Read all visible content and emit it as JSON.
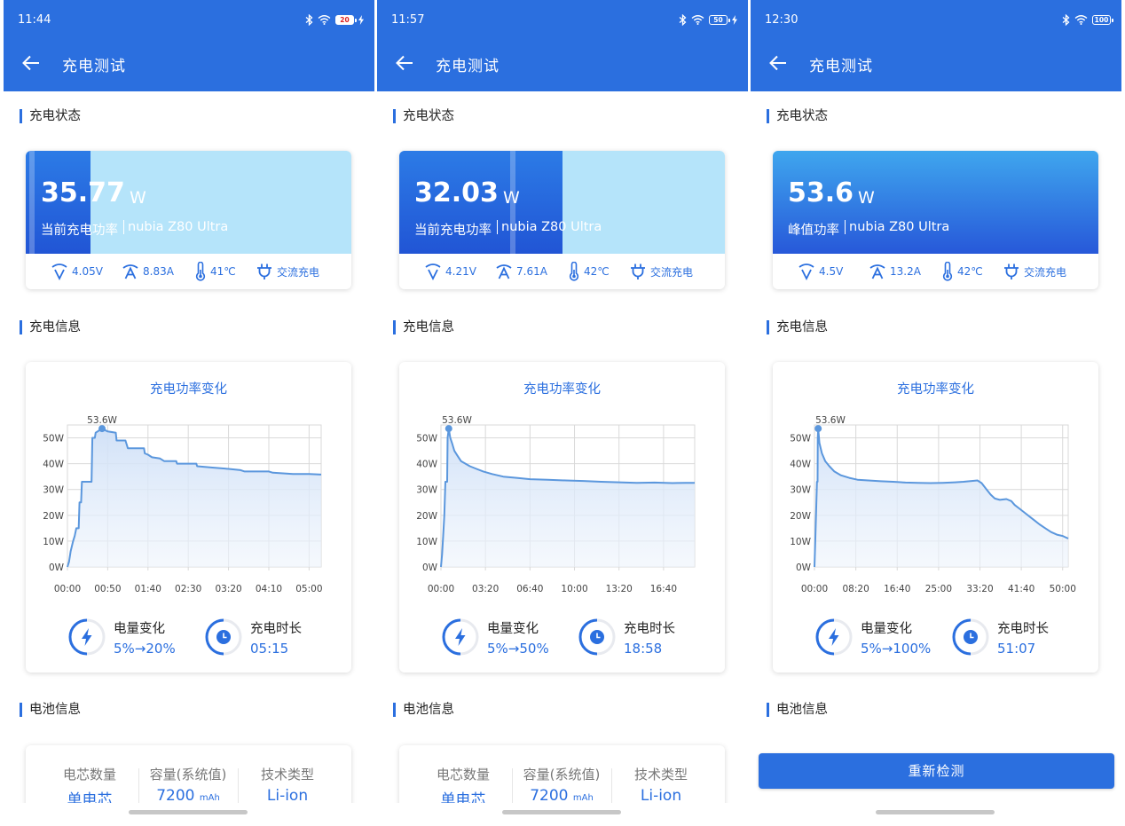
{
  "screens": [
    {
      "status_time": "11:44",
      "battery_level": "20",
      "battery_low": true,
      "charging_bolt": true,
      "title": "充电测试",
      "section_status": "充电状态",
      "power_value": "35.77",
      "power_unit": "W",
      "power_label": "当前充电功率",
      "device": "nubia Z80 Ultra",
      "power_fraction": 0.2,
      "voltage": "4.05V",
      "current": "8.83A",
      "temperature": "41℃",
      "mode": "交流充电",
      "section_info": "充电信息",
      "chart_title": "充电功率变化",
      "summary_battery_label": "电量变化",
      "summary_battery_value": "5%→20%",
      "summary_time_label": "充电时长",
      "summary_time_value": "05:15",
      "section_battery": "电池信息",
      "battery_info": {
        "cells_label": "电芯数量",
        "cells_value": "单电芯",
        "capacity_label": "容量(系统值)",
        "capacity_value": "7200",
        "capacity_unit": "mAh",
        "tech_label": "技术类型",
        "tech_value": "Li-ion"
      }
    },
    {
      "status_time": "11:57",
      "battery_level": "50",
      "battery_low": false,
      "charging_bolt": true,
      "title": "充电测试",
      "section_status": "充电状态",
      "power_value": "32.03",
      "power_unit": "W",
      "power_label": "当前充电功率",
      "device": "nubia Z80 Ultra",
      "power_fraction": 0.5,
      "voltage": "4.21V",
      "current": "7.61A",
      "temperature": "42℃",
      "mode": "交流充电",
      "section_info": "充电信息",
      "chart_title": "充电功率变化",
      "summary_battery_label": "电量变化",
      "summary_battery_value": "5%→50%",
      "summary_time_label": "充电时长",
      "summary_time_value": "18:58",
      "section_battery": "电池信息",
      "battery_info": {
        "cells_label": "电芯数量",
        "cells_value": "单电芯",
        "capacity_label": "容量(系统值)",
        "capacity_value": "7200",
        "capacity_unit": "mAh",
        "tech_label": "技术类型",
        "tech_value": "Li-ion"
      }
    },
    {
      "status_time": "12:30",
      "battery_level": "100",
      "battery_low": false,
      "charging_bolt": false,
      "title": "充电测试",
      "section_status": "充电状态",
      "power_value": "53.6",
      "power_unit": "W",
      "power_label": "峰值功率",
      "device": "nubia Z80 Ultra",
      "power_fraction": 1.0,
      "voltage": "4.5V",
      "current": "13.2A",
      "temperature": "42℃",
      "mode": "交流充电",
      "section_info": "充电信息",
      "chart_title": "充电功率变化",
      "summary_battery_label": "电量变化",
      "summary_battery_value": "5%→100%",
      "summary_time_label": "充电时长",
      "summary_time_value": "51:07",
      "section_battery": "电池信息",
      "redetect_label": "重新检测"
    }
  ],
  "colors": {
    "primary": "#2b6fdf",
    "light_fill": "#b5e4fa",
    "chart_line": "#5b97dd",
    "grid": "#d9d9d9"
  },
  "icons": [
    "back-arrow-icon",
    "bluetooth-icon",
    "wifi-icon",
    "battery-icon",
    "charging-bolt-icon",
    "voltage-icon",
    "current-icon",
    "thermometer-icon",
    "plug-icon",
    "bolt-ring-icon",
    "clock-ring-icon"
  ],
  "chart_data": [
    {
      "type": "area",
      "title": "充电功率变化",
      "ylim": [
        0,
        55
      ],
      "yticks": [
        "0W",
        "10W",
        "20W",
        "30W",
        "40W",
        "50W"
      ],
      "xlim": [
        0,
        315
      ],
      "xticks": [
        "00:00",
        "00:50",
        "01:40",
        "02:30",
        "03:20",
        "04:10",
        "05:00"
      ],
      "xtick_values": [
        0,
        50,
        100,
        150,
        200,
        250,
        300
      ],
      "grid": true,
      "peak_label": "53.6W",
      "peak": [
        43,
        53.6
      ],
      "points": [
        [
          0,
          0
        ],
        [
          2,
          2
        ],
        [
          4,
          6
        ],
        [
          7,
          10
        ],
        [
          9,
          12
        ],
        [
          11,
          15
        ],
        [
          14,
          15
        ],
        [
          15,
          25
        ],
        [
          17,
          25
        ],
        [
          18,
          33
        ],
        [
          30,
          33
        ],
        [
          31,
          50
        ],
        [
          34,
          50
        ],
        [
          35,
          52
        ],
        [
          43,
          53.6
        ],
        [
          50,
          52.5
        ],
        [
          60,
          52
        ],
        [
          61,
          49
        ],
        [
          72,
          49
        ],
        [
          75,
          46
        ],
        [
          95,
          46
        ],
        [
          96,
          44
        ],
        [
          100,
          43.5
        ],
        [
          105,
          42.5
        ],
        [
          115,
          42
        ],
        [
          120,
          41
        ],
        [
          135,
          41
        ],
        [
          136,
          40
        ],
        [
          160,
          40
        ],
        [
          161,
          39
        ],
        [
          180,
          38.5
        ],
        [
          200,
          38
        ],
        [
          215,
          37.5
        ],
        [
          220,
          37
        ],
        [
          250,
          37
        ],
        [
          255,
          36.5
        ],
        [
          280,
          36
        ],
        [
          300,
          36
        ],
        [
          315,
          35.8
        ]
      ]
    },
    {
      "type": "area",
      "title": "充电功率变化",
      "ylim": [
        0,
        55
      ],
      "yticks": [
        "0W",
        "10W",
        "20W",
        "30W",
        "40W",
        "50W"
      ],
      "xlim": [
        0,
        1140
      ],
      "xticks": [
        "00:00",
        "03:20",
        "06:40",
        "10:00",
        "13:20",
        "16:40"
      ],
      "xtick_values": [
        0,
        200,
        400,
        600,
        800,
        1000
      ],
      "grid": true,
      "peak_label": "53.6W",
      "peak": [
        35,
        53.6
      ],
      "points": [
        [
          0,
          0
        ],
        [
          5,
          5
        ],
        [
          10,
          12
        ],
        [
          15,
          20
        ],
        [
          20,
          33
        ],
        [
          28,
          33
        ],
        [
          30,
          50
        ],
        [
          35,
          53.6
        ],
        [
          42,
          50
        ],
        [
          50,
          48
        ],
        [
          60,
          45
        ],
        [
          75,
          43
        ],
        [
          90,
          41
        ],
        [
          110,
          40
        ],
        [
          130,
          39
        ],
        [
          160,
          38
        ],
        [
          190,
          37
        ],
        [
          230,
          36
        ],
        [
          280,
          35
        ],
        [
          340,
          34.5
        ],
        [
          400,
          34
        ],
        [
          480,
          33.8
        ],
        [
          560,
          33.5
        ],
        [
          640,
          33.3
        ],
        [
          720,
          33
        ],
        [
          800,
          32.8
        ],
        [
          880,
          32.6
        ],
        [
          960,
          32.7
        ],
        [
          1040,
          32.5
        ],
        [
          1100,
          32.6
        ],
        [
          1140,
          32.6
        ]
      ]
    },
    {
      "type": "area",
      "title": "充电功率变化",
      "ylim": [
        0,
        55
      ],
      "yticks": [
        "0W",
        "10W",
        "20W",
        "30W",
        "40W",
        "50W"
      ],
      "xlim": [
        0,
        3067
      ],
      "xticks": [
        "00:00",
        "08:20",
        "16:40",
        "25:00",
        "33:20",
        "41:40",
        "50:00"
      ],
      "xtick_values": [
        0,
        500,
        1000,
        1500,
        2000,
        2500,
        3000
      ],
      "grid": true,
      "peak_label": "53.6W",
      "peak": [
        45,
        53.6
      ],
      "points": [
        [
          0,
          0
        ],
        [
          10,
          10
        ],
        [
          20,
          22
        ],
        [
          30,
          33
        ],
        [
          38,
          33
        ],
        [
          40,
          50
        ],
        [
          45,
          53.6
        ],
        [
          60,
          48
        ],
        [
          90,
          44
        ],
        [
          130,
          41
        ],
        [
          180,
          39
        ],
        [
          240,
          37
        ],
        [
          320,
          35.5
        ],
        [
          420,
          34.5
        ],
        [
          520,
          33.8
        ],
        [
          650,
          33.5
        ],
        [
          800,
          33.2
        ],
        [
          950,
          33
        ],
        [
          1100,
          32.7
        ],
        [
          1250,
          32.6
        ],
        [
          1400,
          32.5
        ],
        [
          1550,
          32.6
        ],
        [
          1700,
          32.8
        ],
        [
          1800,
          33
        ],
        [
          1900,
          33.3
        ],
        [
          1970,
          33.5
        ],
        [
          2020,
          32.5
        ],
        [
          2080,
          30
        ],
        [
          2130,
          28
        ],
        [
          2180,
          26.5
        ],
        [
          2240,
          26
        ],
        [
          2320,
          26.3
        ],
        [
          2380,
          25.5
        ],
        [
          2420,
          24
        ],
        [
          2480,
          22.5
        ],
        [
          2540,
          21
        ],
        [
          2600,
          19.5
        ],
        [
          2660,
          18
        ],
        [
          2720,
          16.5
        ],
        [
          2790,
          15
        ],
        [
          2860,
          13.5
        ],
        [
          2930,
          12.5
        ],
        [
          3000,
          12
        ],
        [
          3067,
          11
        ]
      ]
    }
  ]
}
